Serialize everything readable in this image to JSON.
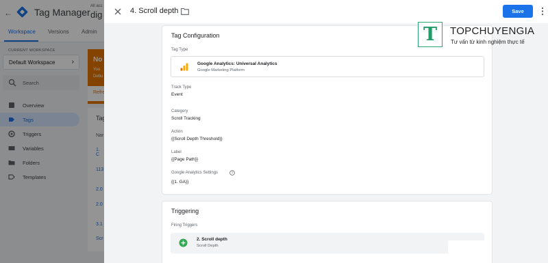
{
  "app": {
    "name": "Tag Manager",
    "account_small": "All acc",
    "account_big": "dig"
  },
  "subnav": {
    "tabs": [
      {
        "label": "Workspace",
        "active": true
      },
      {
        "label": "Versions",
        "active": false
      },
      {
        "label": "Admin",
        "active": false
      }
    ]
  },
  "sidebar": {
    "workspace_label": "CURRENT WORKSPACE",
    "workspace_name": "Default Workspace",
    "search_placeholder": "Search",
    "items": [
      {
        "label": "Overview",
        "icon": "overview-icon",
        "active": false
      },
      {
        "label": "Tags",
        "icon": "tag-icon",
        "active": true
      },
      {
        "label": "Triggers",
        "icon": "trigger-icon",
        "active": false
      },
      {
        "label": "Variables",
        "icon": "variables-icon",
        "active": false
      },
      {
        "label": "Folders",
        "icon": "folder-icon",
        "active": false
      },
      {
        "label": "Templates",
        "icon": "template-icon",
        "active": false
      }
    ]
  },
  "background": {
    "notice_title": "No",
    "notice_line1": "You",
    "notice_line2": "Debu",
    "notice_link": "Refre",
    "table_title": "Tag",
    "table_header": "Nar",
    "rows": [
      "1. C",
      "113",
      "2.0",
      "2.0",
      "3.1",
      "Scr"
    ]
  },
  "panel": {
    "title": "4. Scroll depth",
    "save_label": "Save",
    "config": {
      "heading": "Tag Configuration",
      "tag_type_label": "Tag Type",
      "tag_type_name": "Google Analytics: Universal Analytics",
      "tag_type_sub": "Google Marketing Platform",
      "track_type_label": "Track Type",
      "track_type_value": "Event",
      "category_label": "Category",
      "category_value": "Scroll Tracking",
      "action_label": "Action",
      "action_value": "{{Scroll Depth Threshold}}",
      "label_label": "Label",
      "label_value": "{{Page Path}}",
      "ga_settings_label": "Google Analytics Settings",
      "ga_settings_value": "{{1. GA}}"
    },
    "triggering": {
      "heading": "Triggering",
      "firing_label": "Firing Triggers",
      "trigger_name": "2. Scroll depth",
      "trigger_sub": "Scroll Depth"
    }
  },
  "watermark": {
    "letter": "T",
    "brand": "TOPCHUYENGIA",
    "tagline": "Tư vấn từ kinh nghiệm thực tế"
  },
  "colors": {
    "accent": "#1a73e8",
    "notice": "#e37400",
    "watermark": "#1f9c67",
    "trigger_green": "#34a853"
  }
}
